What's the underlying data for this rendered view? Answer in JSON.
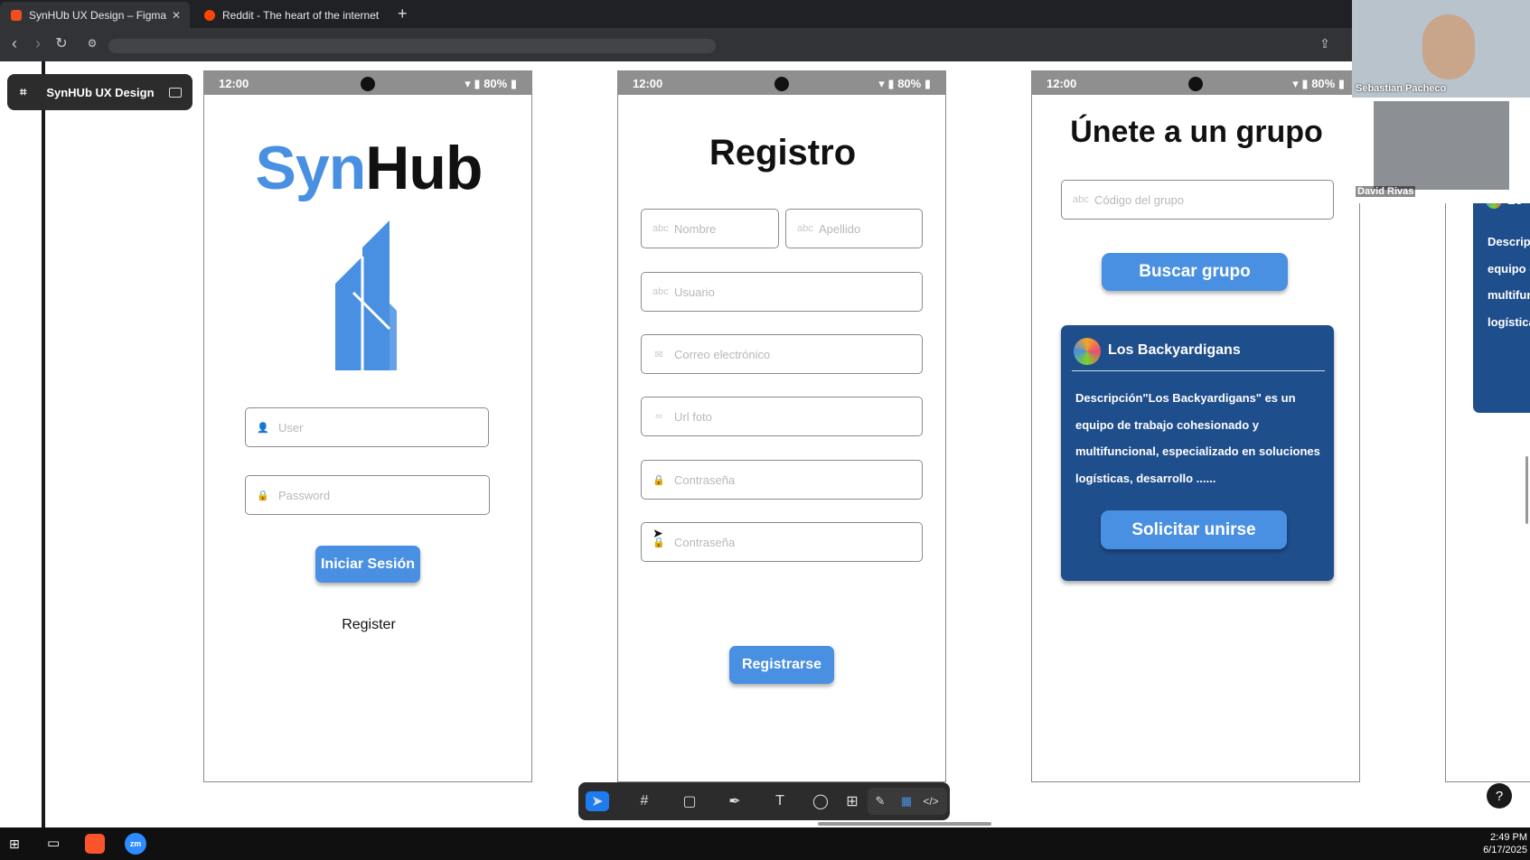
{
  "browser": {
    "tabs": [
      {
        "label": "SynHUb UX Design – Figma",
        "active": true
      },
      {
        "label": "Reddit - The heart of the internet",
        "active": false
      }
    ],
    "new_tab": "+"
  },
  "figma": {
    "file_name": "SynHUb UX Design"
  },
  "status_bar": {
    "time": "12:00",
    "battery": "80%"
  },
  "login_screen": {
    "logo_syn": "Syn",
    "logo_hub": "Hub",
    "user_placeholder": "User",
    "password_placeholder": "Password",
    "login_button": "Iniciar Sesión",
    "register_link": "Register"
  },
  "register_screen": {
    "title": "Registro",
    "fields": [
      "Nombre",
      "Apellido",
      "Usuario",
      "Correo electrónico",
      "Url foto",
      "Contraseña",
      "Contraseña"
    ],
    "submit_button": "Registrarse"
  },
  "group_screen": {
    "title": "Únete a un grupo",
    "code_placeholder": "Código del grupo",
    "search_button": "Buscar grupo",
    "card": {
      "name": "Los Backyardigans",
      "description_lines": [
        "Descripción\"Los Backyardigans\" es un",
        "equipo de trabajo cohesionado y",
        "multifuncional, especializado en soluciones",
        "logísticas, desarrollo ......"
      ],
      "join_button": "Solicitar unirse"
    }
  },
  "partial_screen": {
    "heading_fragment": "Lo",
    "lines": [
      "Descrip",
      "equipo c",
      "multifun",
      "logística"
    ]
  },
  "video_call": {
    "participants": [
      "Sebastian Pacheco",
      "David Rivas"
    ]
  },
  "taskbar": {
    "time": "2:49 PM",
    "date": "6/17/2025"
  },
  "help": "?",
  "colors": {
    "accent": "#4a90e2",
    "card_bg": "#1f4e8c",
    "logo_hub": "#111111"
  }
}
